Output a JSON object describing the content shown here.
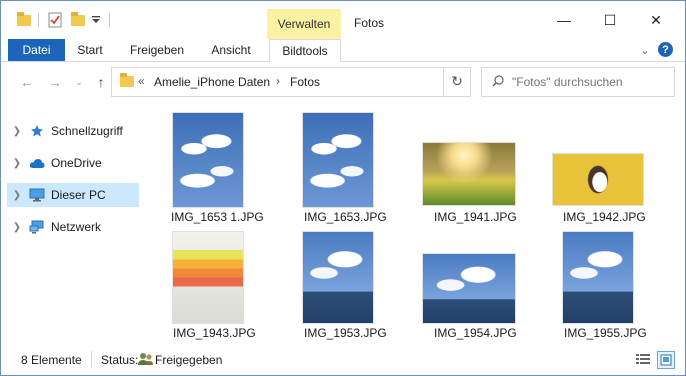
{
  "window": {
    "title": "Fotos",
    "context_tab_group": "Verwalten",
    "controls": {
      "minimize": "—",
      "maximize": "☐",
      "close": "✕"
    }
  },
  "ribbon": {
    "tabs": [
      {
        "label": "Datei"
      },
      {
        "label": "Start"
      },
      {
        "label": "Freigeben"
      },
      {
        "label": "Ansicht"
      },
      {
        "label": "Bildtools"
      }
    ],
    "expand_glyph": "⌄",
    "help_glyph": "?"
  },
  "address": {
    "overflow": "«",
    "crumbs": [
      "Amelie_iPhone Daten",
      "Fotos"
    ],
    "separator": "›"
  },
  "search": {
    "placeholder": "\"Fotos\" durchsuchen"
  },
  "nav": {
    "items": [
      {
        "label": "Schnellzugriff",
        "icon": "star-icon"
      },
      {
        "label": "OneDrive",
        "icon": "cloud-icon"
      },
      {
        "label": "Dieser PC",
        "icon": "monitor-icon",
        "selected": true
      },
      {
        "label": "Netzwerk",
        "icon": "network-icon"
      }
    ]
  },
  "files": [
    {
      "name": "IMG_1653 1.JPG",
      "kind": "sky-portrait"
    },
    {
      "name": "IMG_1653.JPG",
      "kind": "sky-portrait"
    },
    {
      "name": "IMG_1941.JPG",
      "kind": "garden-landscape"
    },
    {
      "name": "IMG_1942.JPG",
      "kind": "dog-landscape"
    },
    {
      "name": "IMG_1943.JPG",
      "kind": "girl-portrait"
    },
    {
      "name": "IMG_1953.JPG",
      "kind": "sky-building-portrait"
    },
    {
      "name": "IMG_1954.JPG",
      "kind": "sky-building-landscape"
    },
    {
      "name": "IMG_1955.JPG",
      "kind": "sky-building-portrait"
    }
  ],
  "status": {
    "count": "8 Elemente",
    "state_label": "Status:",
    "state_value": "Freigegeben"
  },
  "colors": {
    "accent": "#1c65b8",
    "verwalten_bg": "#fbf1a2",
    "selected_bg": "#cce8ff"
  }
}
